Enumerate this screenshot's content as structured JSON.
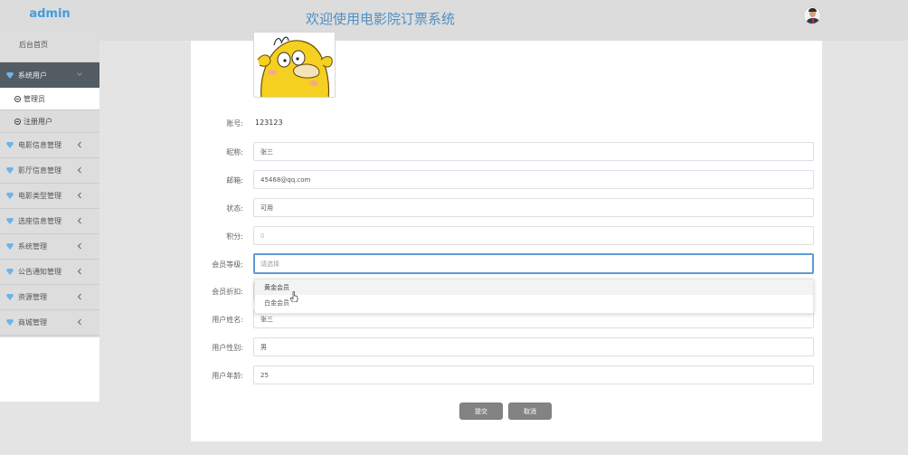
{
  "header": {
    "brand": "admin",
    "title": "欢迎使用电影院订票系统",
    "avatar_icon": "user-avatar"
  },
  "sidebar": {
    "home": "后台首页",
    "system_users": {
      "label": "系统用户",
      "children": [
        "管理员",
        "注册用户"
      ]
    },
    "items": [
      "电影信息管理",
      "影厅信息管理",
      "电影类型管理",
      "选座信息管理",
      "系统管理",
      "公告通知管理",
      "资源管理",
      "商城管理"
    ]
  },
  "form": {
    "account": {
      "label": "账号:",
      "value": "123123"
    },
    "nickname": {
      "label": "昵称:",
      "value": "张三"
    },
    "email": {
      "label": "邮箱:",
      "value": "45468@qq.com"
    },
    "status": {
      "label": "状态:",
      "value": "可用"
    },
    "points": {
      "label": "积分:",
      "value": "0"
    },
    "level": {
      "label": "会员等级:",
      "placeholder": "请选择"
    },
    "discount": {
      "label": "会员折扣:"
    },
    "name": {
      "label": "用户姓名:",
      "value": "张三"
    },
    "gender": {
      "label": "用户性别:",
      "value": "男"
    },
    "age": {
      "label": "用户年龄:",
      "value": "25"
    }
  },
  "dropdown": {
    "options": [
      "黄金会员",
      "白金会员"
    ]
  },
  "buttons": {
    "submit": "提交",
    "cancel": "取消"
  },
  "colors": {
    "accent": "#5d9bd6",
    "brand": "#3d9de0",
    "sidebar_active": "#535b63",
    "button": "#838383"
  }
}
